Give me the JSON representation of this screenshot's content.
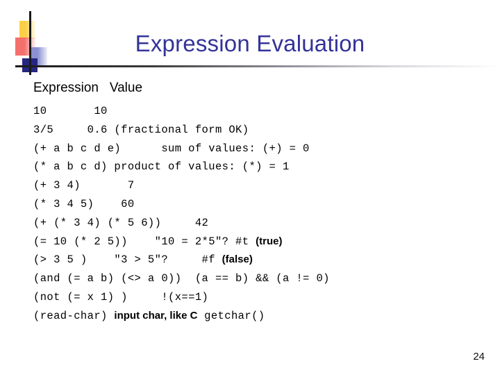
{
  "slide": {
    "title": "Expression Evaluation",
    "page_number": "24",
    "colors": {
      "title": "#333399",
      "logo_yellow": "#fbcf46",
      "logo_red": "#f4706d",
      "logo_periwinkle": "#8b90d2",
      "logo_navy": "#262680",
      "rule": "#1a1a1a",
      "text": "#000000"
    }
  },
  "table": {
    "header": "Expression   Value",
    "rows": [
      {
        "mono": "10       10",
        "note": "",
        "mono_tail": ""
      },
      {
        "mono": "3/5     0.6 (fractional form OK)",
        "note": "",
        "mono_tail": ""
      },
      {
        "mono": "(+ a b c d e)      sum of values: (+) = 0",
        "note": "",
        "mono_tail": ""
      },
      {
        "mono": "(* a b c d) product of values: (*) = 1",
        "note": "",
        "mono_tail": ""
      },
      {
        "mono": "(+ 3 4)       7",
        "note": "",
        "mono_tail": ""
      },
      {
        "mono": "(* 3 4 5)    60",
        "note": "",
        "mono_tail": ""
      },
      {
        "mono": "(+ (* 3 4) (* 5 6))     42",
        "note": "",
        "mono_tail": ""
      },
      {
        "mono": "(= 10 (* 2 5))    \"10 = 2*5\"? #t ",
        "note": "(true)",
        "mono_tail": ""
      },
      {
        "mono": "(> 3 5 )    \"3 > 5\"?     #f ",
        "note": "(false)",
        "mono_tail": ""
      },
      {
        "mono": "(and (= a b) (<> a 0))  (a == b) && (a != 0)",
        "note": "",
        "mono_tail": ""
      },
      {
        "mono": "(not (= x 1) )     !(x==1)",
        "note": "",
        "mono_tail": ""
      },
      {
        "mono": "(read-char) ",
        "note": "input char, like C",
        "mono_tail": " getchar()"
      }
    ]
  }
}
